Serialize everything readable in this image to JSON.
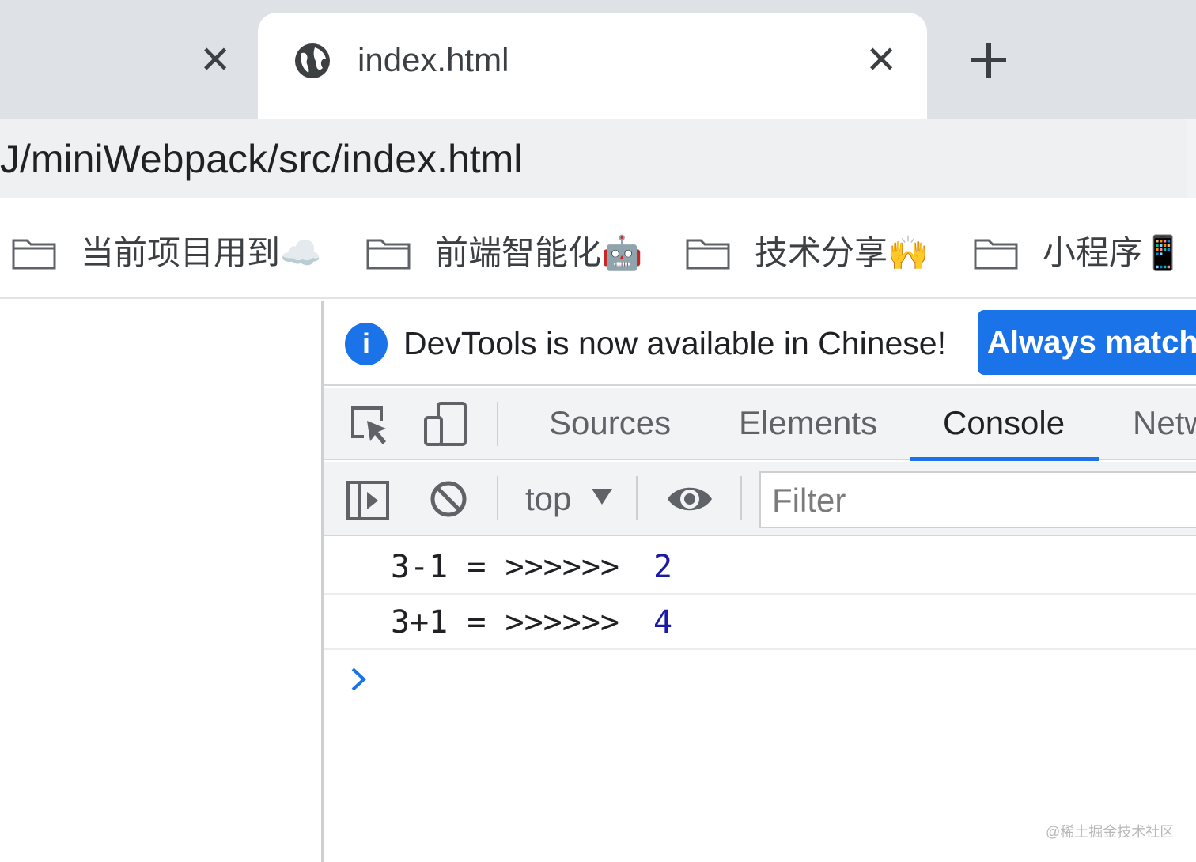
{
  "browser": {
    "tabs": [
      {
        "title": "",
        "close_glyph": "✕",
        "active": false
      },
      {
        "title": "index.html",
        "close_glyph": "✕",
        "active": true,
        "favicon": "globe-icon"
      }
    ],
    "new_tab_glyph": "plus-icon",
    "url": "J/miniWebpack/src/index.html"
  },
  "bookmarks": [
    {
      "label": "当前项目用到☁️",
      "icon": "folder-icon"
    },
    {
      "label": "前端智能化🤖",
      "icon": "folder-icon"
    },
    {
      "label": "技术分享🙌",
      "icon": "folder-icon"
    },
    {
      "label": "小程序📱",
      "icon": "folder-icon"
    }
  ],
  "devtools": {
    "infobar": {
      "icon": "info-icon",
      "icon_glyph": "i",
      "message": "DevTools is now available in Chinese!",
      "button_label": "Always match"
    },
    "tabs": [
      {
        "label": "Sources",
        "active": false
      },
      {
        "label": "Elements",
        "active": false
      },
      {
        "label": "Console",
        "active": true
      },
      {
        "label": "Network",
        "active": false
      }
    ],
    "toolbar": {
      "context": "top",
      "filter_placeholder": "Filter"
    },
    "console": {
      "logs": [
        {
          "text": "3-1 = >>>>>>",
          "value": "2"
        },
        {
          "text": "3+1 = >>>>>>",
          "value": "4"
        }
      ],
      "prompt_glyph": "chevron-right-icon"
    },
    "accent_color": "#1a73e8",
    "value_color": "#1a1aa6"
  },
  "watermark": "@稀土掘金技术社区"
}
